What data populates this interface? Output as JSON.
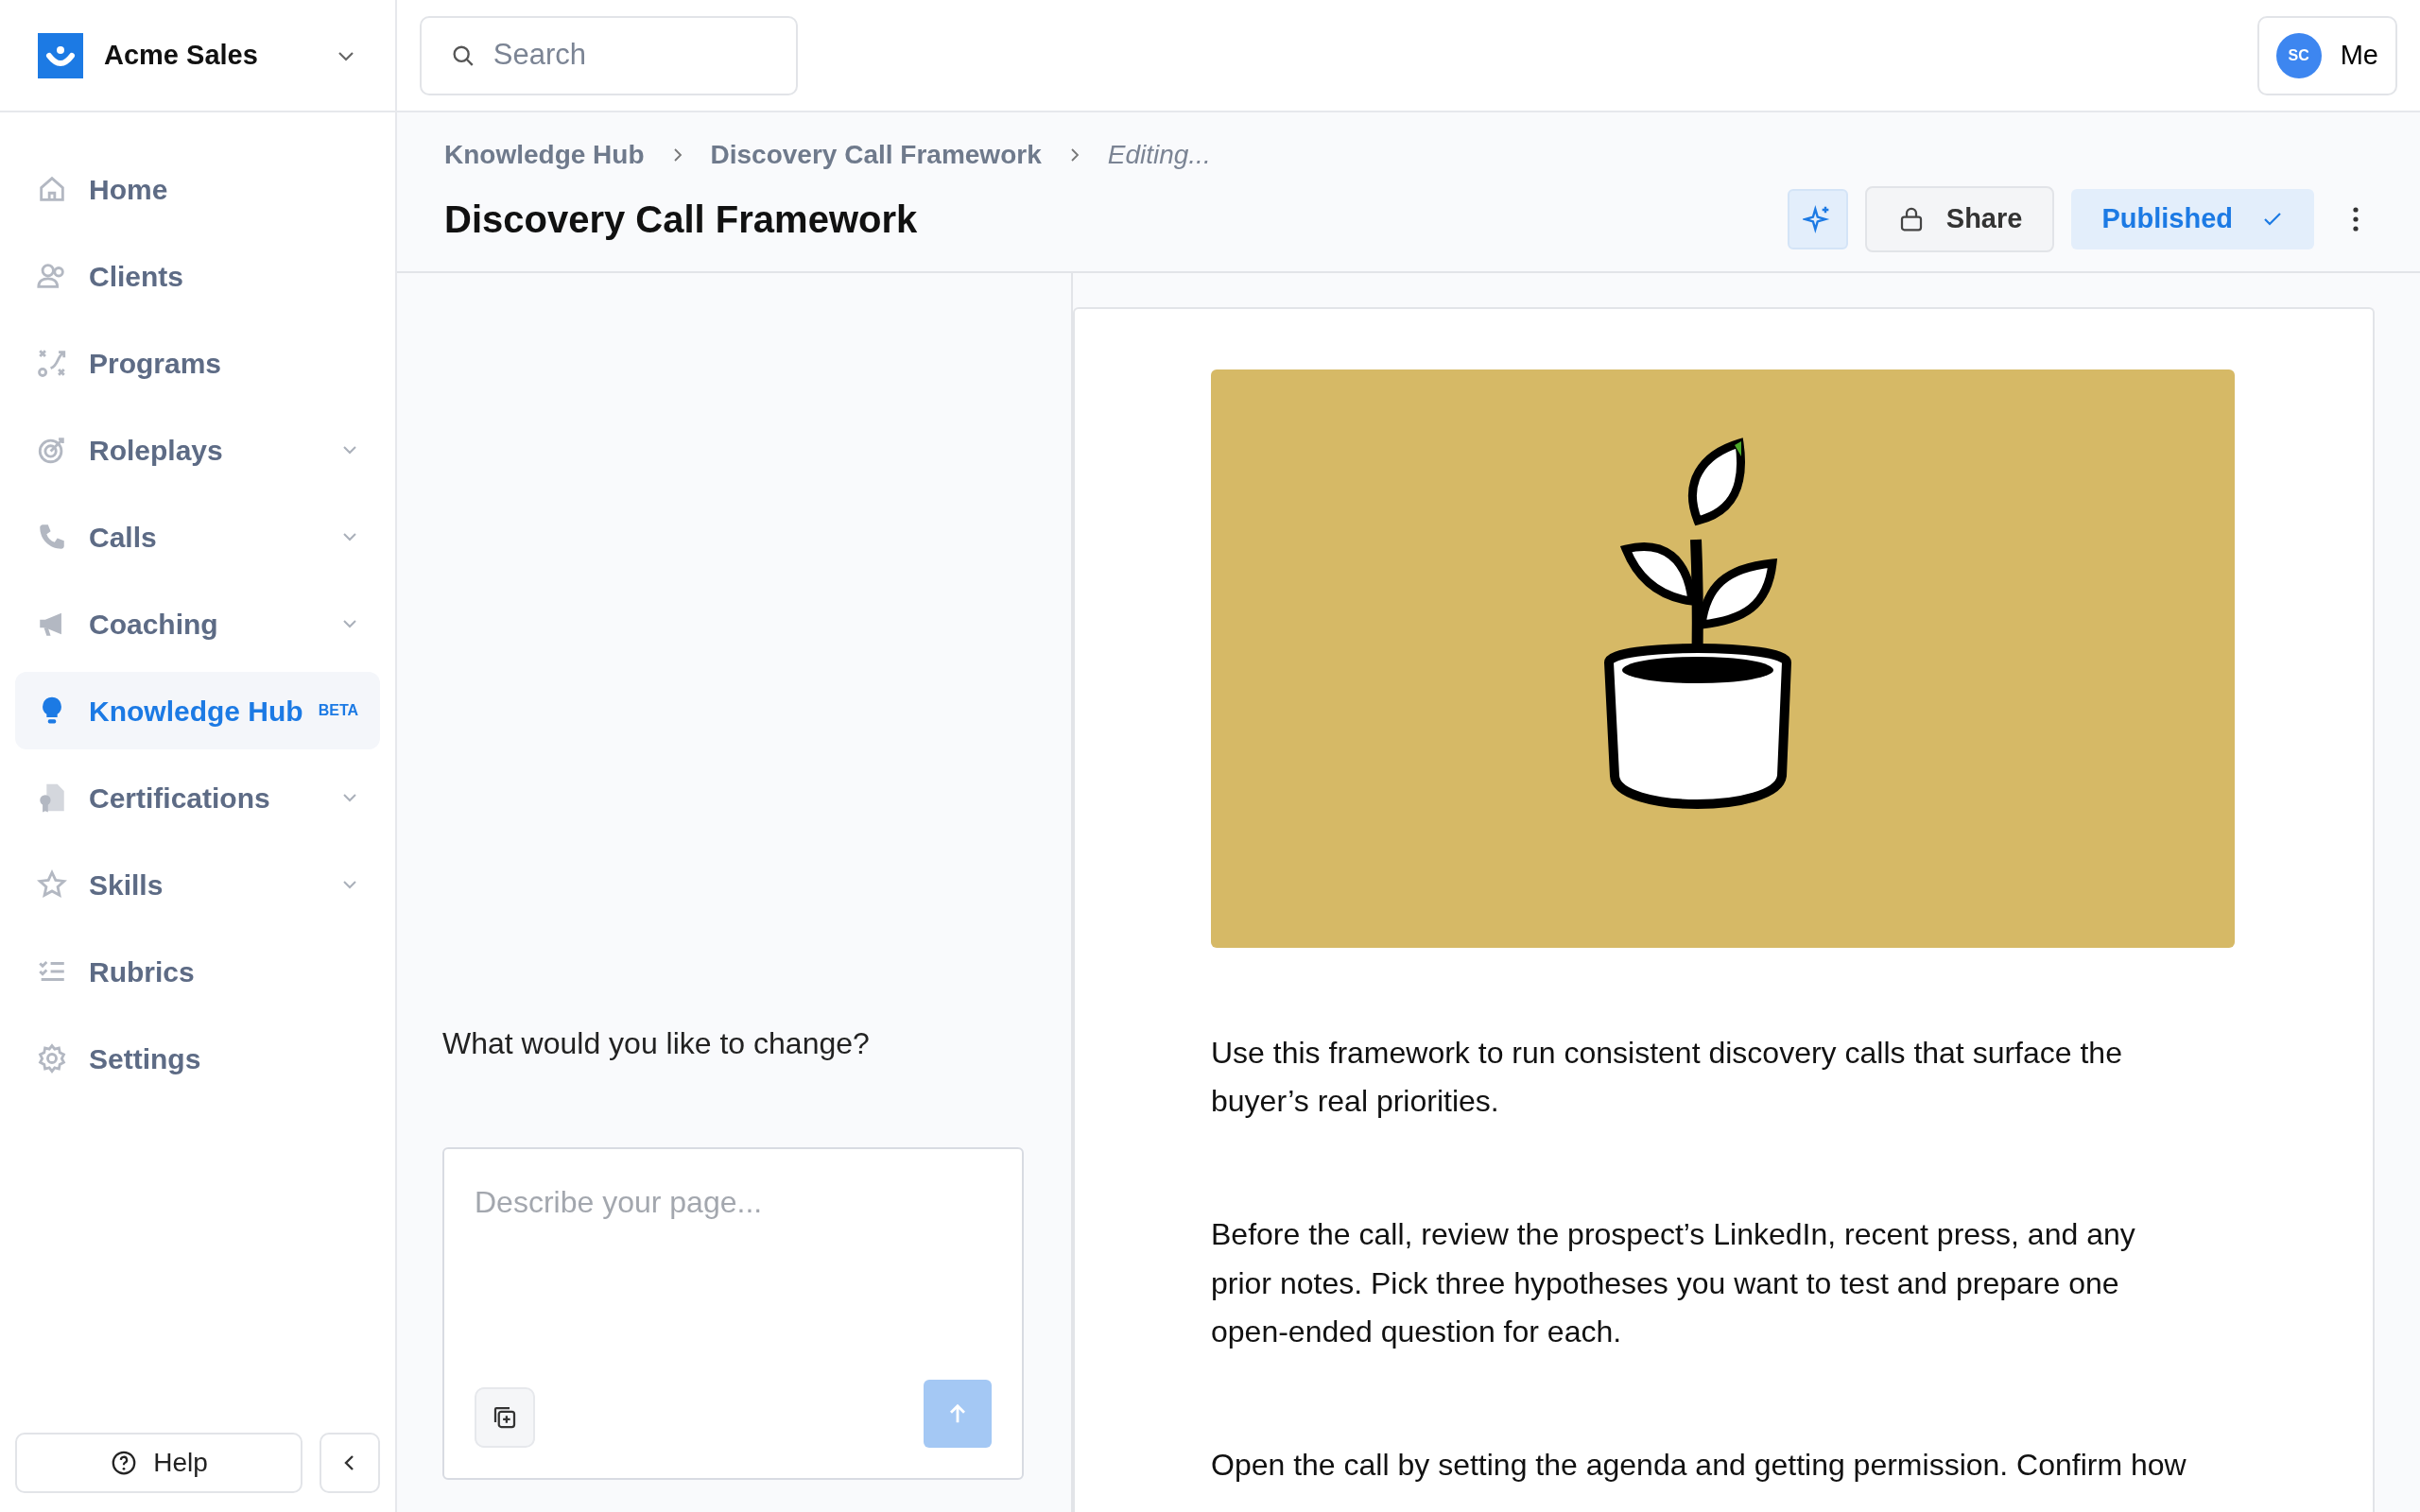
{
  "brand": {
    "name": "Acme Sales"
  },
  "search": {
    "placeholder": "Search"
  },
  "user": {
    "initials": "SC",
    "label": "Me"
  },
  "sidebar": {
    "items": [
      {
        "label": "Home",
        "expandable": false,
        "selected": false
      },
      {
        "label": "Clients",
        "expandable": false,
        "selected": false
      },
      {
        "label": "Programs",
        "expandable": false,
        "selected": false
      },
      {
        "label": "Roleplays",
        "expandable": true,
        "selected": false
      },
      {
        "label": "Calls",
        "expandable": true,
        "selected": false
      },
      {
        "label": "Coaching",
        "expandable": true,
        "selected": false
      },
      {
        "label": "Knowledge Hub",
        "expandable": false,
        "selected": true,
        "badge": "BETA"
      },
      {
        "label": "Certifications",
        "expandable": true,
        "selected": false
      },
      {
        "label": "Skills",
        "expandable": true,
        "selected": false
      },
      {
        "label": "Rubrics",
        "expandable": false,
        "selected": false
      },
      {
        "label": "Settings",
        "expandable": false,
        "selected": false
      }
    ],
    "help": "Help"
  },
  "breadcrumb": [
    {
      "label": "Knowledge Hub",
      "kind": "link"
    },
    {
      "label": "Discovery Call Framework",
      "kind": "link"
    },
    {
      "label": "Editing...",
      "kind": "status"
    }
  ],
  "page_title": "Discovery Call Framework",
  "actions": {
    "share": "Share",
    "publish": "Published"
  },
  "editor": {
    "prompt": "What would you like to change?",
    "placeholder": "Describe your page..."
  },
  "document": {
    "paragraphs": [
      "Use this framework to run consistent discovery calls that surface the buyer’s real priorities.",
      "Before the call, review the prospect’s LinkedIn, recent press, and any prior notes. Pick three hypotheses you want to test and prepare one open-ended question for each.",
      "Open the call by setting the agenda and getting permission. Confirm how"
    ]
  }
}
